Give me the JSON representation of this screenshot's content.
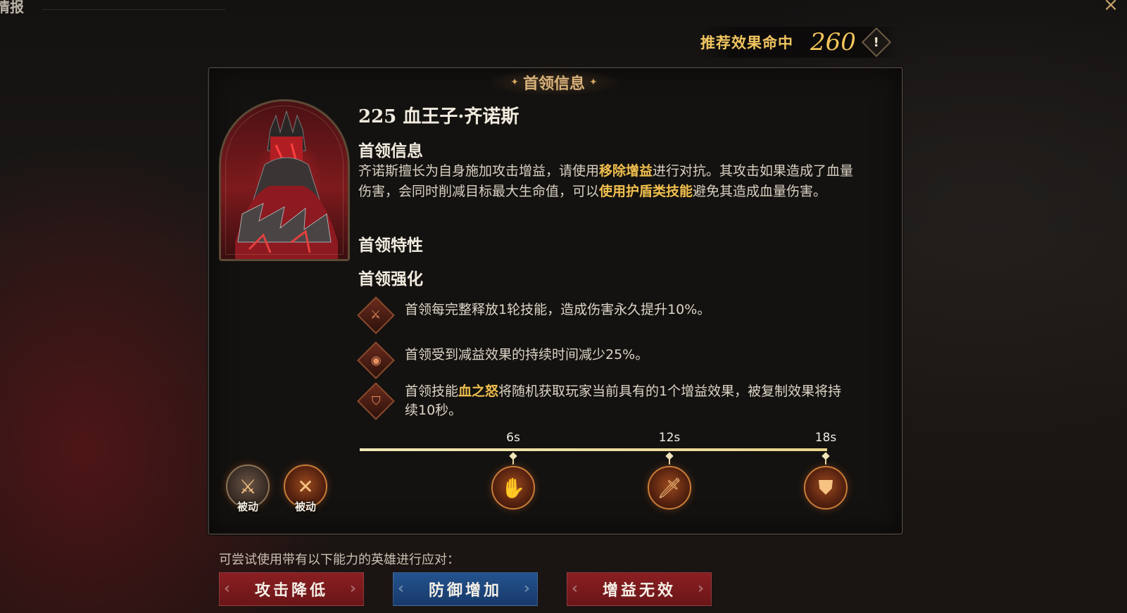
{
  "header": {
    "page_title": "情报",
    "close_icon": "close-x-icon"
  },
  "recommend": {
    "label": "推荐效果命中",
    "value": "260",
    "info_icon": "!"
  },
  "panel": {
    "title": "首领信息",
    "boss_name": "225 血王子·齐诺斯",
    "info_section_title": "首领信息",
    "description": {
      "part1": "齐诺斯擅长为自身施加攻击增益，请使用",
      "highlight1": "移除增益",
      "part2": "进行对抗。其攻击如果造成了血量伤害，会同时削减目标最大生命值，可以",
      "highlight2": "使用护盾类技能",
      "part3": "避免其造成血量伤害。"
    },
    "traits_title": "首领特性",
    "enhance_title": "首领强化",
    "enhancements": [
      {
        "icon": "sword-burst-icon",
        "text": "首领每完整释放1轮技能，造成伤害永久提升10%。"
      },
      {
        "icon": "debuff-eye-icon",
        "text": "首领受到减益效果的持续时间减少25%。"
      },
      {
        "pre": "首领技能",
        "highlight": "血之怒",
        "post": "将随机获取玩家当前具有的1个增益效果，被复制效果将持续10秒。",
        "icon": "shield-crest-icon"
      }
    ]
  },
  "passives": [
    {
      "label": "被动",
      "icon": "sword-shield-icon"
    },
    {
      "label": "被动",
      "icon": "crossed-blades-icon"
    }
  ],
  "timeline": {
    "marks": [
      {
        "label": "6s",
        "icon": "claw-hand-icon"
      },
      {
        "label": "12s",
        "icon": "flaming-dagger-icon"
      },
      {
        "label": "18s",
        "icon": "burning-armor-icon"
      }
    ]
  },
  "counters": {
    "hint": "可尝试使用带有以下能力的英雄进行应对：",
    "buttons": [
      {
        "label": "攻击降低",
        "color": "#7a1a1d"
      },
      {
        "label": "防御增加",
        "color": "#1f4a82"
      },
      {
        "label": "增益无效",
        "color": "#7a1a1d"
      }
    ]
  }
}
